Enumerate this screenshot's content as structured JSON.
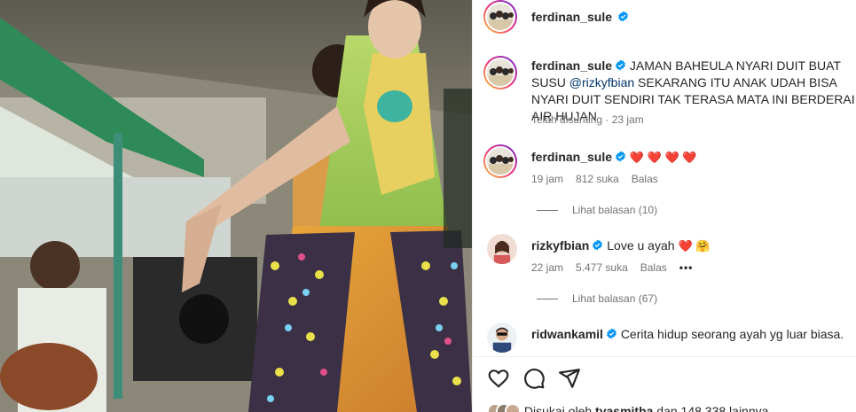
{
  "post": {
    "author": "ferdinan_sule",
    "caption_parts": {
      "line_start": "JAMAN BAHEULA NYARI DUIT BUAT SUSU",
      "mention": "@rizkyfbian",
      "line_rest": "SEKARANG ITU ANAK UDAH BISA NYARI DUIT SENDIRI TAK TERASA MATA INI BERDERAI AIR HUJAN"
    },
    "caption_meta": "Telah disunting · 23 jam"
  },
  "comments": [
    {
      "username": "ferdinan_sule",
      "text": "",
      "hearts": "❤️ ❤️ ❤️ ❤️",
      "time": "19 jam",
      "likes": "812 suka",
      "reply": "Balas",
      "view_replies": "Lihat balasan (10)"
    },
    {
      "username": "rizkyfbian",
      "text": "Love u ayah",
      "emoji": "❤️ 🤗",
      "time": "22 jam",
      "likes": "5.477 suka",
      "reply": "Balas",
      "more": "•••",
      "view_replies": "Lihat balasan (67)"
    },
    {
      "username": "ridwankamil",
      "text": "Cerita hidup seorang ayah yg luar biasa."
    }
  ],
  "likes_line": {
    "prefix": "Disukai oleh",
    "user": "tyasmitha",
    "suffix": "dan 148.338 lainnya"
  },
  "icons": [
    "verified-badge-icon",
    "heart-outline-icon",
    "comment-icon",
    "share-icon"
  ],
  "colors": {
    "verified": "#0095f6",
    "mention": "#00376b",
    "secondary_text": "#737373",
    "heart": "#ed1c24"
  }
}
